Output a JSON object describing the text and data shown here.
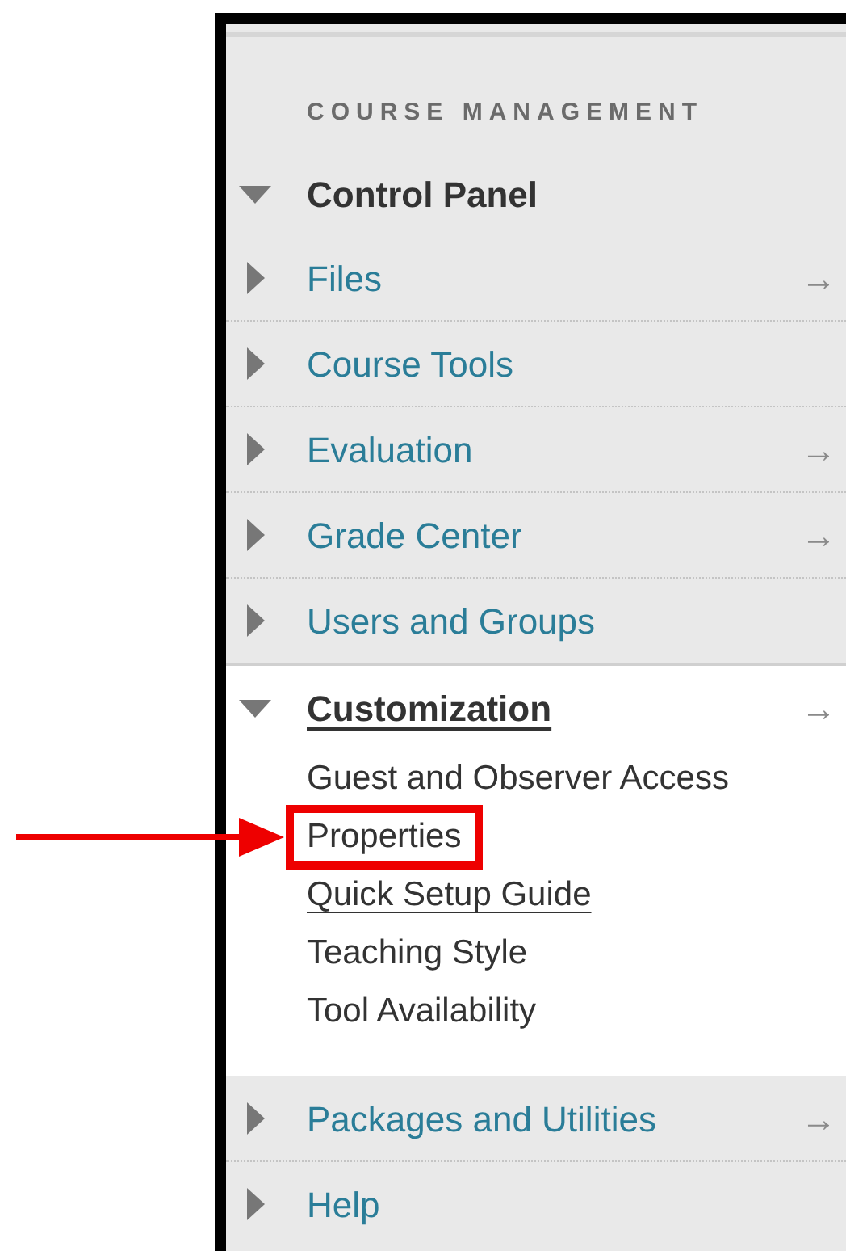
{
  "heading": "COURSE MANAGEMENT",
  "control_panel": {
    "label": "Control Panel",
    "expanded": true
  },
  "sections": [
    {
      "label": "Files",
      "expanded": false,
      "underlined": false,
      "arrow": "→"
    },
    {
      "label": "Course Tools",
      "expanded": false,
      "underlined": false
    },
    {
      "label": "Evaluation",
      "expanded": false,
      "underlined": false,
      "arrow": "→"
    },
    {
      "label": "Grade Center",
      "expanded": false,
      "underlined": false,
      "arrow": "→"
    },
    {
      "label": "Users and Groups",
      "expanded": false,
      "underlined": false
    },
    {
      "label": "Customization",
      "expanded": true,
      "underlined": true,
      "arrow": "→",
      "children": [
        {
          "label": "Guest and Observer Access",
          "underlined": false,
          "highlighted": false
        },
        {
          "label": "Properties",
          "underlined": false,
          "highlighted": true
        },
        {
          "label": "Quick Setup Guide",
          "underlined": true,
          "highlighted": false
        },
        {
          "label": "Teaching Style",
          "underlined": false,
          "highlighted": false
        },
        {
          "label": "Tool Availability",
          "underlined": false,
          "highlighted": false
        }
      ]
    },
    {
      "label": "Packages and Utilities",
      "expanded": false,
      "underlined": false,
      "arrow": "→"
    },
    {
      "label": "Help",
      "expanded": false,
      "underlined": false
    }
  ]
}
